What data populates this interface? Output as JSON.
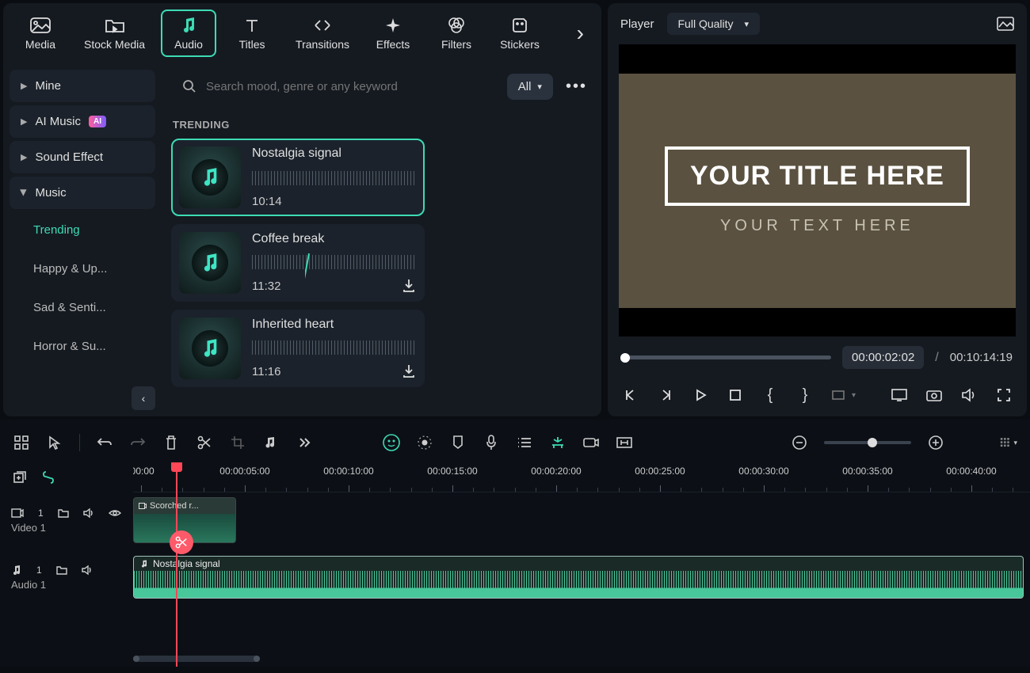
{
  "tabs": {
    "items": [
      "Media",
      "Stock Media",
      "Audio",
      "Titles",
      "Transitions",
      "Effects",
      "Filters",
      "Stickers"
    ],
    "active_index": 2
  },
  "sidebar": {
    "mine": "Mine",
    "ai_music": "AI Music",
    "ai_badge": "AI",
    "sound_effect": "Sound Effect",
    "music": "Music",
    "subs": [
      "Trending",
      "Happy & Up...",
      "Sad & Senti...",
      "Horror & Su..."
    ],
    "active_sub": 0
  },
  "search": {
    "placeholder": "Search mood, genre or any keyword",
    "filter_label": "All"
  },
  "section_title": "TRENDING",
  "tracks": [
    {
      "name": "Nostalgia signal",
      "duration": "10:14",
      "selected": true,
      "downloadable": false
    },
    {
      "name": "Coffee break",
      "duration": "11:32",
      "selected": false,
      "downloadable": true
    },
    {
      "name": "Inherited heart",
      "duration": "11:16",
      "selected": false,
      "downloadable": true
    }
  ],
  "player": {
    "label": "Player",
    "quality": "Full Quality",
    "preview_title": "YOUR TITLE HERE",
    "preview_subtitle": "YOUR TEXT HERE",
    "current_time": "00:00:02:02",
    "total_time": "00:10:14:19"
  },
  "timeline": {
    "ruler": [
      ":00:00",
      "00:00:05:00",
      "00:00:10:00",
      "00:00:15:00",
      "00:00:20:00",
      "00:00:25:00",
      "00:00:30:00",
      "00:00:35:00",
      "00:00:40:00"
    ],
    "video_track_label": "Video 1",
    "audio_track_label": "Audio 1",
    "video_clip_name": "Scorched r...",
    "audio_clip_name": "Nostalgia signal",
    "video_track_num": "1",
    "audio_track_num": "1"
  }
}
